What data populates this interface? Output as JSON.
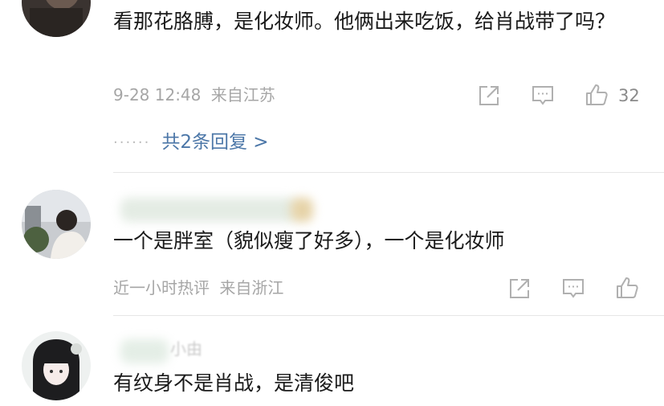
{
  "comments": [
    {
      "text": "看那花胳膊，是化妆师。他俩出来吃饭，给肖战带了吗？",
      "time": "9-28 12:48",
      "location": "来自江苏",
      "like_count": "32",
      "reply_link": "共2条回复 >",
      "reply_dots": "······"
    },
    {
      "text": "一个是胖室（貌似瘦了好多），一个是化妆师",
      "time": "近一小时热评",
      "location": "来自浙江"
    },
    {
      "partial_username": "小由",
      "text": "有纹身不是肖战，是清俊吧"
    }
  ],
  "icons": {
    "share": "share-icon",
    "comment": "comment-icon",
    "like": "thumbs-up-icon"
  },
  "colors": {
    "text": "#1a1a1a",
    "meta": "#a6a6a6",
    "link": "#4c77a8",
    "icon": "#b0b0b0",
    "divider": "#e6e6e6"
  }
}
